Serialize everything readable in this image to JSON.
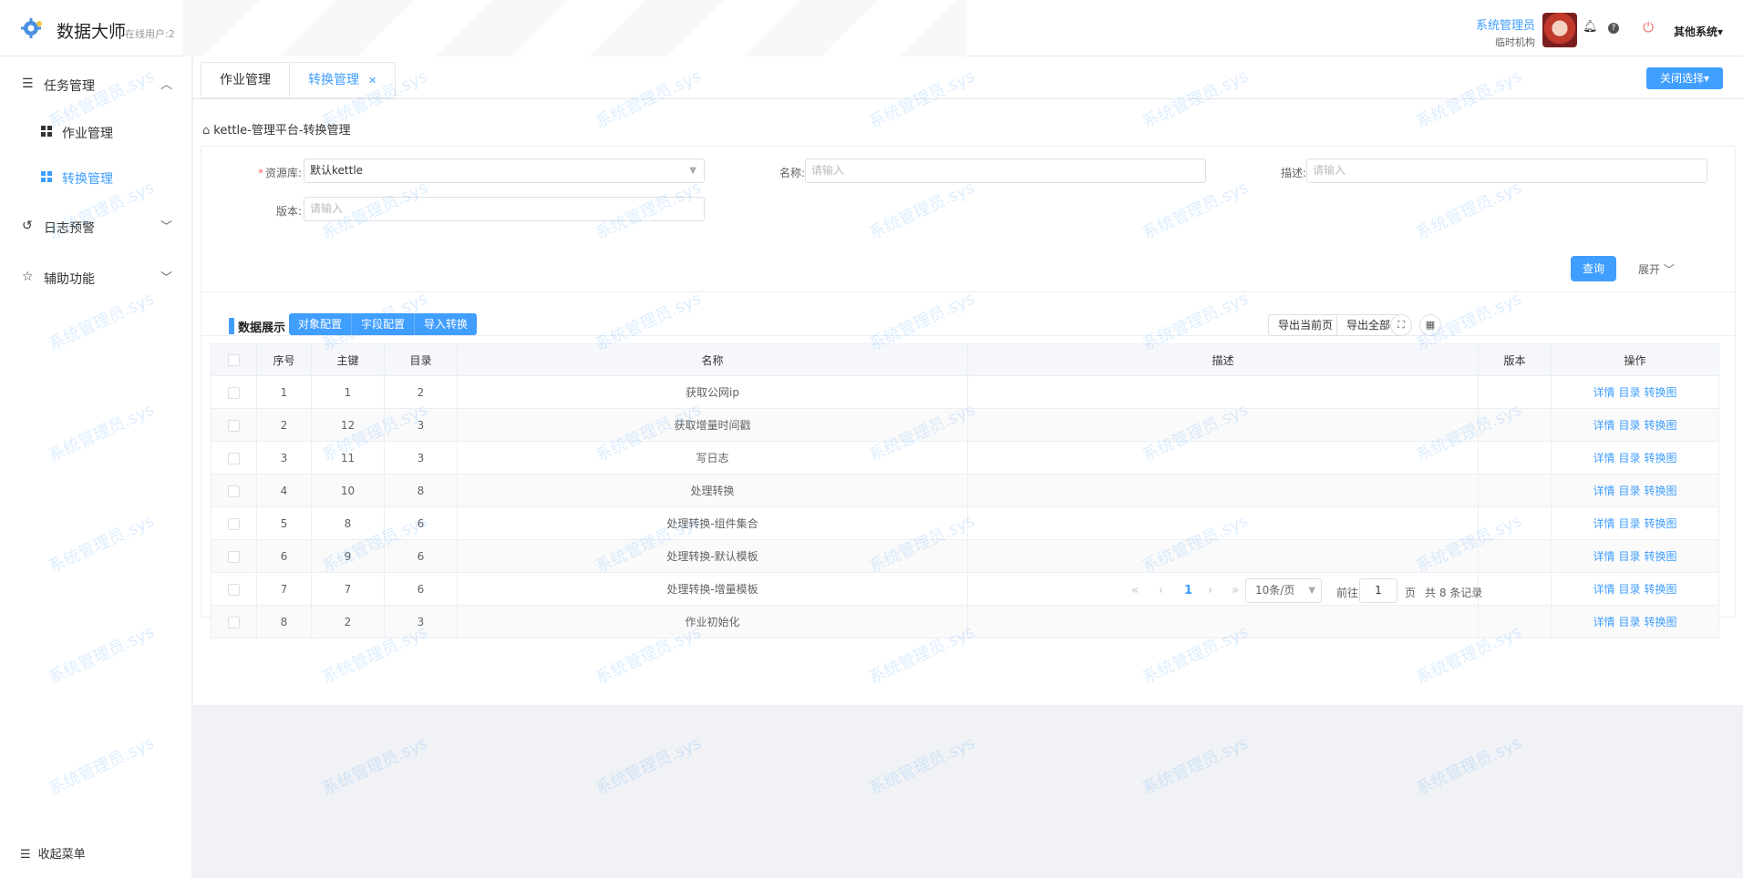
{
  "header": {
    "app_title": "数据大师",
    "online_users": "在线用户:2",
    "user_name": "系统管理员",
    "user_org": "临时机构",
    "other_systems": "其他系统▾"
  },
  "sidebar": {
    "groups": [
      {
        "label": "任务管理",
        "icon": "menu-icon",
        "expanded": true
      },
      {
        "label": "日志预警",
        "icon": "history-icon",
        "expanded": false
      },
      {
        "label": "辅助功能",
        "icon": "star-icon",
        "expanded": false
      }
    ],
    "sub_items": [
      {
        "label": "作业管理",
        "active": false
      },
      {
        "label": "转换管理",
        "active": true
      }
    ],
    "collapse_label": "收起菜单"
  },
  "tabs": [
    {
      "label": "作业管理",
      "active": false
    },
    {
      "label": "转换管理",
      "active": true
    }
  ],
  "close_select_label": "关闭选择▾",
  "breadcrumb": "kettle-管理平台-转换管理",
  "search": {
    "repo_label": "资源库:",
    "repo_value": "默认kettle",
    "name_label": "名称:",
    "name_placeholder": "请输入",
    "desc_label": "描述:",
    "desc_placeholder": "请输入",
    "version_label": "版本:",
    "version_placeholder": "请输入",
    "query_label": "查询",
    "expand_label": "展开"
  },
  "table_panel": {
    "title": "数据展示",
    "actions": [
      "对象配置",
      "字段配置",
      "导入转换"
    ],
    "export_page": "导出当前页",
    "export_all": "导出全部",
    "columns": [
      "序号",
      "主键",
      "目录",
      "名称",
      "描述",
      "版本",
      "操作"
    ],
    "row_ops": [
      "详情",
      "目录",
      "转换图"
    ],
    "rows": [
      {
        "no": "1",
        "id": "1",
        "dir": "2",
        "name": "获取公网ip",
        "desc": "",
        "ver": ""
      },
      {
        "no": "2",
        "id": "12",
        "dir": "3",
        "name": "获取增量时间戳",
        "desc": "",
        "ver": ""
      },
      {
        "no": "3",
        "id": "11",
        "dir": "3",
        "name": "写日志",
        "desc": "",
        "ver": ""
      },
      {
        "no": "4",
        "id": "10",
        "dir": "8",
        "name": "处理转换",
        "desc": "",
        "ver": ""
      },
      {
        "no": "5",
        "id": "8",
        "dir": "6",
        "name": "处理转换-组件集合",
        "desc": "",
        "ver": ""
      },
      {
        "no": "6",
        "id": "9",
        "dir": "6",
        "name": "处理转换-默认模板",
        "desc": "",
        "ver": ""
      },
      {
        "no": "7",
        "id": "7",
        "dir": "6",
        "name": "处理转换-增量模板",
        "desc": "",
        "ver": ""
      },
      {
        "no": "8",
        "id": "2",
        "dir": "3",
        "name": "作业初始化",
        "desc": "",
        "ver": ""
      }
    ]
  },
  "pagination": {
    "current_page": "1",
    "page_size": "10条/页",
    "goto_label": "前往",
    "goto_value": "1",
    "page_unit": "页",
    "total": "共 8 条记录"
  },
  "watermark": "系统管理员.sys",
  "colors": {
    "accent": "#409eff",
    "danger": "#f56c6c"
  }
}
